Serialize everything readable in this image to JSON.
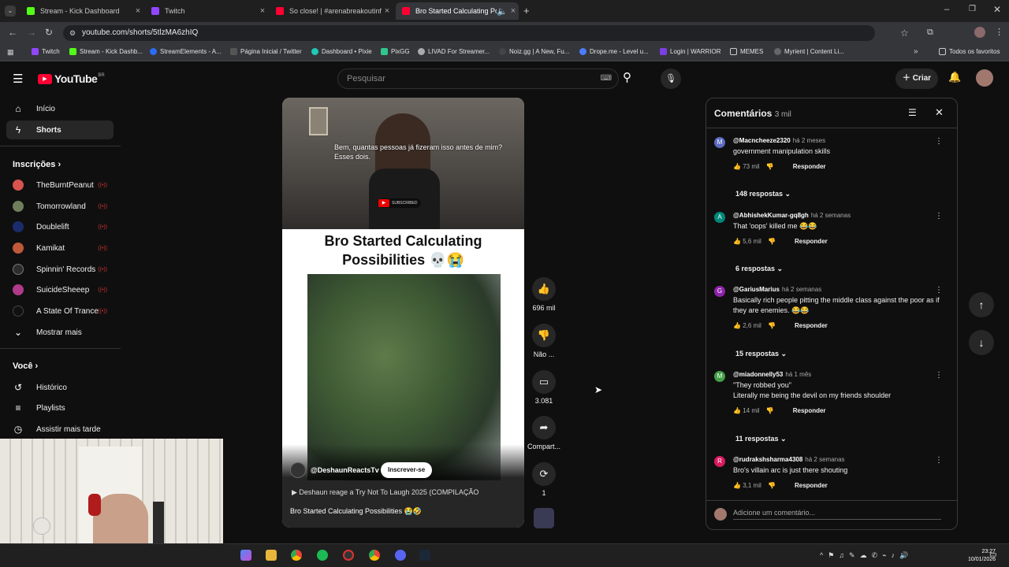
{
  "tabs": [
    {
      "title": "Stream - Kick Dashboard",
      "color": "#53fc18"
    },
    {
      "title": "Twitch",
      "color": "#9146ff"
    },
    {
      "title": "So close! | #arenabreakoutinfin",
      "color": "#ff0033"
    },
    {
      "title": "Bro Started Calculating Pos",
      "color": "#ff0033"
    }
  ],
  "url": "youtube.com/shorts/5tlzMA6zhIQ",
  "bookmarks": [
    "Twitch",
    "Stream - Kick Dashb...",
    "StreamElements - A...",
    "Página Inicial / Twitter",
    "Dashboard • Pixie",
    "PixGG",
    "LIVAD For Streamer...",
    "Noiz.gg | A New, Fu...",
    "Drope.me - Level u...",
    "Login | WARRIOR",
    "MEMES",
    "Myrient | Content Li...",
    "Todos os favoritos"
  ],
  "youtube": {
    "logo": "YouTube",
    "region": "BR",
    "search_placeholder": "Pesquisar",
    "create_label": "Criar"
  },
  "sidebar": {
    "inicio": "Início",
    "shorts": "Shorts",
    "inscricoes": "Inscrições",
    "channels": [
      "TheBurntPeanut",
      "Tomorrowland",
      "Doublelift",
      "Kamikat",
      "Spinnin' Records",
      "SuicideSheeep",
      "A State Of Trance"
    ],
    "show_more": "Mostrar mais",
    "voce": "Você",
    "historico": "Histórico",
    "playlists": "Playlists",
    "assistir": "Assistir mais tarde"
  },
  "short": {
    "caption_line1": "Bem, quantas pessoas já fizeram isso antes de mim?",
    "caption_line2": "Esses dois.",
    "subscribed_badge": "SUBSCRIBED",
    "title": "Bro Started Calculating Possibilities 💀😭",
    "channel": "@DeshaunReactsTv",
    "subscribe_label": "Inscrever-se",
    "source": "Deshaun reage a Try Not To Laugh 2025 (COMPILAÇÃO",
    "bottom_title": "Bro Started Calculating Possibilities 😭🤣"
  },
  "actions": {
    "likes": "696 mil",
    "dislike": "Não ...",
    "comments": "3.081",
    "share": "Compart...",
    "remix": "1"
  },
  "comments": {
    "title": "Comentários",
    "count": "3 mil",
    "add_placeholder": "Adicione um comentário...",
    "reply_label": "Responder",
    "items": [
      {
        "initial": "M",
        "color": "#5c6bc0",
        "author": "@Macncheeze2320",
        "time": "há 2 meses",
        "text": "government manipulation skills",
        "likes": "73 mil",
        "replies": "148 respostas"
      },
      {
        "initial": "A",
        "color": "#00897b",
        "author": "@AbhishekKumar-gq8gh",
        "time": "há 2 semanas",
        "text": "That 'oops' killed me 😂😂",
        "likes": "5,6 mil",
        "replies": "6 respostas"
      },
      {
        "initial": "G",
        "color": "#8e24aa",
        "author": "@GariusMarius",
        "time": "há 2 semanas",
        "text": "Basically rich people pitting the middle class against the poor as if they are enemies. 😂😂",
        "likes": "2,6 mil",
        "replies": "15 respostas"
      },
      {
        "initial": "M",
        "color": "#43a047",
        "author": "@miadonnelly53",
        "time": "há 1 mês",
        "text": "\"They robbed you\"\nLiterally me being the devil on my friends shoulder",
        "likes": "14 mil",
        "replies": "11 respostas"
      },
      {
        "initial": "R",
        "color": "#d81b60",
        "author": "@rudrakshsharma4308",
        "time": "há 2 semanas",
        "text": "Bro's villain arc is just there shouting",
        "likes": "3,1 mil",
        "replies": ""
      }
    ]
  },
  "taskbar": {
    "time": "23:27",
    "date": "10/01/2026"
  }
}
